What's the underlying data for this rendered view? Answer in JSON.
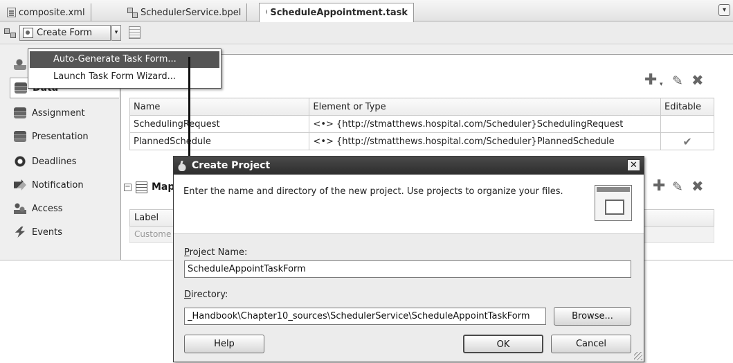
{
  "tabs": [
    {
      "label": "composite.xml",
      "icon": "xml-file-icon",
      "active": false
    },
    {
      "label": "SchedulerService.bpel",
      "icon": "bpel-process-icon",
      "active": false
    },
    {
      "label": "ScheduleAppointment.task",
      "icon": "human-task-icon",
      "active": true
    }
  ],
  "toolbar": {
    "create_form_label": "Create Form"
  },
  "create_form_menu": {
    "items": [
      {
        "label": "Auto-Generate Task Form...",
        "highlighted": true
      },
      {
        "label": "Launch Task Form Wizard...",
        "highlighted": false
      }
    ]
  },
  "sidebar": {
    "items": [
      {
        "label": "Data",
        "icon": "data-stack-icon",
        "active": true
      },
      {
        "label": "Assignment",
        "icon": "assignment-icon"
      },
      {
        "label": "Presentation",
        "icon": "presentation-icon"
      },
      {
        "label": "Deadlines",
        "icon": "deadlines-icon"
      },
      {
        "label": "Notification",
        "icon": "notification-icon"
      },
      {
        "label": "Access",
        "icon": "access-icon"
      },
      {
        "label": "Events",
        "icon": "events-icon"
      }
    ]
  },
  "data_section": {
    "columns": [
      "Name",
      "Element or Type",
      "Editable"
    ],
    "rows": [
      {
        "name": "SchedulingRequest",
        "type": "<•> {http://stmatthews.hospital.com/Scheduler}SchedulingRequest",
        "editable": ""
      },
      {
        "name": "PlannedSchedule",
        "type": "<•> {http://stmatthews.hospital.com/Scheduler}PlannedSchedule",
        "editable": "✔"
      }
    ]
  },
  "mapping_section": {
    "title": "Map",
    "collapse": "−",
    "label_header": "Label",
    "first_value": "Custome"
  },
  "dialog": {
    "title": "Create Project",
    "close": "✕",
    "description": "Enter the name and directory of the new project. Use projects to organize your files.",
    "project_name_label_mnemonic": "P",
    "project_name_label_rest": "roject Name:",
    "project_name_value": "ScheduleAppointTaskForm",
    "directory_label_mnemonic": "D",
    "directory_label_rest": "irectory:",
    "directory_value": "_Handbook\\Chapter10_sources\\SchedulerService\\ScheduleAppointTaskForm",
    "browse_label": "Browse...",
    "help_label": "Help",
    "ok_label": "OK",
    "cancel_label": "Cancel"
  }
}
